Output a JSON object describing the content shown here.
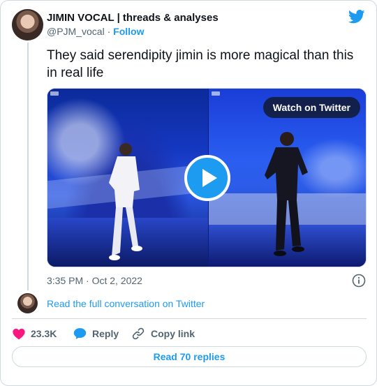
{
  "author": {
    "name": "JIMIN VOCAL | threads & analyses",
    "handle": "@PJM_vocal",
    "separator": "·",
    "follow_label": "Follow"
  },
  "tweet": {
    "text": "They said serendipity jimin is more magical than this in real life",
    "timestamp": "3:35 PM · Oct 2, 2022"
  },
  "media": {
    "watch_label": "Watch on Twitter"
  },
  "thread": {
    "read_conversation_label": "Read the full conversation on Twitter"
  },
  "actions": {
    "like_count": "23.3K",
    "reply_label": "Reply",
    "copy_link_label": "Copy link",
    "read_replies_label": "Read 70 replies"
  },
  "icons": {
    "brand": "twitter-bird-icon",
    "like": "heart-icon",
    "reply": "speech-bubble-icon",
    "copy": "link-icon",
    "info": "info-icon",
    "play": "play-icon"
  },
  "colors": {
    "accent": "#1d9bf0",
    "like": "#f91880",
    "text": "#0f1419",
    "muted": "#536471",
    "border": "#cfd9de"
  }
}
